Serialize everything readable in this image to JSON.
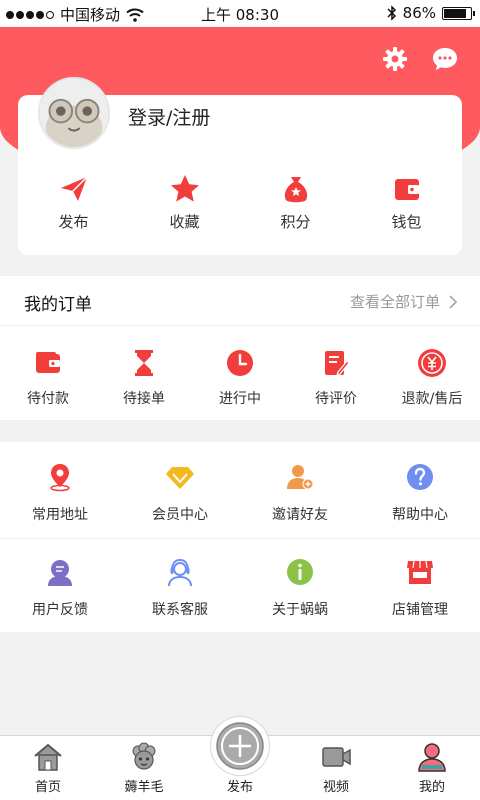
{
  "status_bar": {
    "carrier": "中国移动",
    "time": "上午 08:30",
    "battery": "86%",
    "battery_level": 0.86
  },
  "header": {
    "settings_icon": "gear-icon",
    "message_icon": "chat-bubble-icon"
  },
  "profile": {
    "login_label": "登录/注册",
    "quick_actions": [
      {
        "label": "发布",
        "icon": "paper-plane-icon"
      },
      {
        "label": "收藏",
        "icon": "star-icon"
      },
      {
        "label": "积分",
        "icon": "money-bag-icon"
      },
      {
        "label": "钱包",
        "icon": "wallet-icon"
      }
    ]
  },
  "orders": {
    "title": "我的订单",
    "view_all": "查看全部订单",
    "items": [
      {
        "label": "待付款",
        "icon": "wallet-icon"
      },
      {
        "label": "待接单",
        "icon": "hourglass-icon"
      },
      {
        "label": "进行中",
        "icon": "clock-icon"
      },
      {
        "label": "待评价",
        "icon": "edit-doc-icon"
      },
      {
        "label": "退款/售后",
        "icon": "refund-icon"
      }
    ]
  },
  "services": [
    {
      "label": "常用地址",
      "icon": "location-pin-icon"
    },
    {
      "label": "会员中心",
      "icon": "diamond-icon"
    },
    {
      "label": "邀请好友",
      "icon": "add-user-icon"
    },
    {
      "label": "帮助中心",
      "icon": "help-icon"
    },
    {
      "label": "用户反馈",
      "icon": "feedback-icon"
    },
    {
      "label": "联系客服",
      "icon": "headset-icon"
    },
    {
      "label": "关于蜗蜗",
      "icon": "info-icon"
    },
    {
      "label": "店铺管理",
      "icon": "store-icon"
    }
  ],
  "tabbar": [
    {
      "label": "首页",
      "icon": "home-icon"
    },
    {
      "label": "薅羊毛",
      "icon": "sheep-icon"
    },
    {
      "label": "发布",
      "icon": "plus-circle-icon"
    },
    {
      "label": "视频",
      "icon": "video-camera-icon"
    },
    {
      "label": "我的",
      "icon": "user-icon"
    }
  ],
  "colors": {
    "accent": "#ff5a5f",
    "red": "#f23d3d",
    "gold": "#f2b81e",
    "orange": "#f39a4a",
    "blue": "#6f8ef0",
    "purple": "#7b6fc8",
    "green": "#8bc34a"
  }
}
